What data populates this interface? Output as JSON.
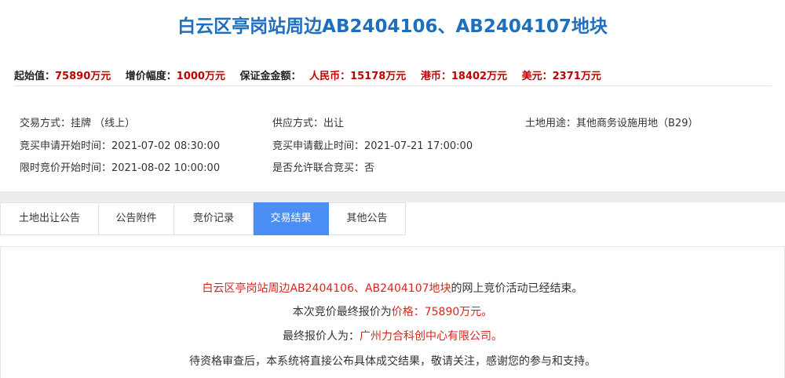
{
  "title": "白云区亭岗站周边AB2404106、AB2404107地块",
  "price_bar": {
    "start_label": "起始值：",
    "start_value": "75890万元",
    "increment_label": "增价幅度：",
    "increment_value": "1000万元",
    "deposit_label": "保证金金额：",
    "rmb_label": "人民币：",
    "rmb_value": "15178万元",
    "hkd_label": "港币：",
    "hkd_value": "18402万元",
    "usd_label": "美元：",
    "usd_value": "2371万元"
  },
  "info": {
    "trade_mode_label": "交易方式：",
    "trade_mode_value": "挂牌 （线上）",
    "supply_mode_label": "供应方式：",
    "supply_mode_value": "出让",
    "land_use_label": "土地用途：",
    "land_use_value": "其他商务设施用地（B29）",
    "apply_start_label": "竞买申请开始时间：",
    "apply_start_value": "2021-07-02 08:30:00",
    "apply_end_label": "竞买申请截止时间：",
    "apply_end_value": "2021-07-21 17:00:00",
    "bid_start_label": "限时竞价开始时间：",
    "bid_start_value": "2021-08-02 10:00:00",
    "joint_label": "是否允许联合竞买：",
    "joint_value": "否"
  },
  "tabs": [
    {
      "label": "土地出让公告"
    },
    {
      "label": "公告附件"
    },
    {
      "label": "竞价记录"
    },
    {
      "label": "交易结果",
      "active": true
    },
    {
      "label": "其他公告"
    }
  ],
  "result": {
    "line1_land": "白云区亭岗站周边AB2404106、AB2404107地块",
    "line1_suffix": "的网上竞价活动已经结束。",
    "line2_prefix": "本次竞价最终报价为",
    "line2_price": "价格：75890万元。",
    "line3_prefix": "最终报价人为：",
    "line3_bidder": "广州力合科创中心有限公司。",
    "line4": "待资格审查后，本系统将直接公布具体成交结果，敬请关注，感谢您的参与和支持。"
  },
  "colors": {
    "title": "#1f6fbf",
    "price_value": "#c00000",
    "highlight": "#d9261c",
    "active_tab": "#4a8ef6"
  }
}
